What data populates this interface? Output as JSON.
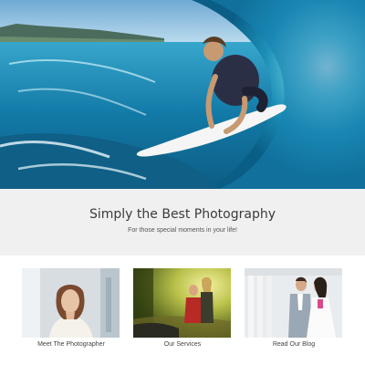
{
  "hero": {
    "image": "surfer-in-wave-photo"
  },
  "band": {
    "title": "Simply the Best Photography",
    "subtitle": "For those special moments in your life!"
  },
  "cards": [
    {
      "image": "photographer-portrait",
      "label": "Meet The Photographer"
    },
    {
      "image": "couple-in-park-photo",
      "label": "Our Services"
    },
    {
      "image": "wedding-couple-photo",
      "label": "Read Our Blog"
    }
  ]
}
